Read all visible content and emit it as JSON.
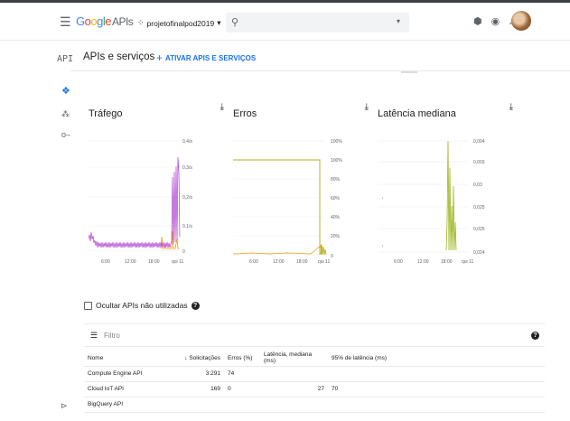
{
  "header": {
    "logo_google": "Google",
    "logo_apis": "APIs",
    "project": "projetofinalpod2019",
    "search_placeholder": ""
  },
  "sidebar": {
    "title": "API"
  },
  "page": {
    "title": "APIs e serviços",
    "enable_button": "ATIVAR APIS E SERVIÇOS"
  },
  "charts": [
    {
      "title": "Tráfego",
      "yticks": [
        "0,4/s",
        "0,3/s",
        "0,2/s",
        "0,1/s",
        "0"
      ],
      "xticks": [
        "6:00",
        "12:00",
        "18:00",
        "qui 11"
      ]
    },
    {
      "title": "Erros",
      "yticks": [
        "100%",
        "100%",
        "80%",
        "60%",
        "40%",
        "20%",
        "0"
      ],
      "xticks": [
        "6:00",
        "12:00",
        "18:00",
        "qui 11"
      ]
    },
    {
      "title": "Latência mediana",
      "yticks": [
        "0,004",
        "0,003",
        "0,03",
        "0,025",
        "0,025",
        "0,024"
      ],
      "xticks": [
        "6:00",
        "12:00",
        "18:00",
        "qui 11"
      ]
    }
  ],
  "chart_data": [
    {
      "type": "line",
      "title": "Tráfego",
      "x": [
        "6:00",
        "12:00",
        "18:00",
        "qui 11"
      ],
      "ylim": [
        0,
        0.4
      ],
      "series": [
        {
          "values": [
            0.05,
            0.03,
            0.03,
            0.03,
            0.03,
            0.03,
            0.04,
            0.3
          ]
        },
        {
          "values": [
            0,
            0,
            0,
            0,
            0,
            0,
            0.1,
            0.05
          ]
        }
      ]
    },
    {
      "type": "line",
      "title": "Erros",
      "x": [
        "6:00",
        "12:00",
        "18:00",
        "qui 11"
      ],
      "ylim": [
        0,
        100
      ],
      "series": [
        {
          "values": [
            100,
            100,
            100,
            100,
            100,
            100,
            100,
            0
          ]
        }
      ]
    },
    {
      "type": "line",
      "title": "Latência mediana",
      "x": [
        "6:00",
        "12:00",
        "18:00",
        "qui 11"
      ]
    }
  ],
  "filter": {
    "label": "Filtro"
  },
  "hide_unused": "Ocultar APIs não utilizadas",
  "table": {
    "headers": [
      "Nome",
      "Solicitações",
      "Erros (%)",
      "Latência, mediana (ms)",
      "95% de latência (ms)"
    ],
    "rows": [
      {
        "name": "Compute Engine API",
        "requests": "3.291",
        "errors": "74",
        "latency": "",
        "p95": ""
      },
      {
        "name": "Cloud IoT API",
        "requests": "169",
        "errors": "0",
        "latency": "27",
        "p95": "70"
      },
      {
        "name": "BigQuery API",
        "requests": "",
        "errors": "",
        "latency": "",
        "p95": ""
      }
    ]
  },
  "colors": {
    "accent": "#1a73e8",
    "traffic_purple": "#b140d1",
    "traffic_orange": "#f29900",
    "errors_olive": "#aab014",
    "latency_olive": "#9bb61e"
  }
}
